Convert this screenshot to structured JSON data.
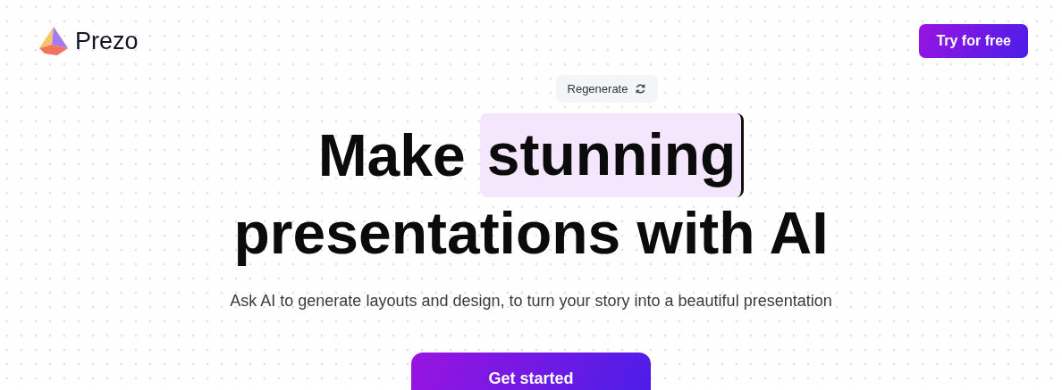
{
  "header": {
    "brand": "Prezo",
    "cta": "Try for free"
  },
  "regenerate": {
    "label": "Regenerate"
  },
  "headline": {
    "lead": "Make",
    "highlight": "stunning",
    "line2": "presentations with AI"
  },
  "subtitle": "Ask AI to generate layouts and design, to turn your story into a beautiful presentation",
  "cta": "Get started"
}
